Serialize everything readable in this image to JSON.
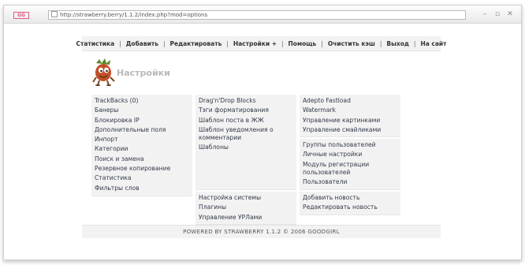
{
  "browser": {
    "app_icon_label": "GG",
    "url": "http://strawberry.berry/1.1.2/index.php?mod=options"
  },
  "menu": [
    {
      "label": "Статистика"
    },
    {
      "label": "Добавить"
    },
    {
      "label": "Редактировать"
    },
    {
      "label": "Настройки +"
    },
    {
      "label": "Помощь"
    },
    {
      "label": "Очистить кэш"
    },
    {
      "label": "Выход"
    },
    {
      "label": "На сайт"
    }
  ],
  "page": {
    "title": "Настройки"
  },
  "columns": {
    "left": [
      {
        "label": "TrackBacks (0)"
      },
      {
        "label": "Банеры"
      },
      {
        "label": "Блокировка IP"
      },
      {
        "label": "Дополнительные поля"
      },
      {
        "label": "Инпорт"
      },
      {
        "label": "Категории"
      },
      {
        "label": "Поиск и замена"
      },
      {
        "label": "Резервное копирование"
      },
      {
        "label": "Статистика"
      },
      {
        "label": "Фильтры слов"
      }
    ],
    "middle_top": [
      {
        "label": "Drag'n'Drop Blocks"
      },
      {
        "label": "Тэги форматирования"
      },
      {
        "label": "Шаблон поста в ЖЖ"
      },
      {
        "label": "Шаблон уведомления о комментарии"
      },
      {
        "label": "Шаблоны"
      }
    ],
    "middle_bottom": [
      {
        "label": "Настройка системы"
      },
      {
        "label": "Плагины"
      },
      {
        "label": "Управление УРЛами"
      }
    ],
    "right_top": [
      {
        "label": "Adepto Fastload"
      },
      {
        "label": "Watermark"
      },
      {
        "label": "Управление картинками"
      },
      {
        "label": "Управление смайликами"
      }
    ],
    "right_middle": [
      {
        "label": "Группы пользователей"
      },
      {
        "label": "Личные настройки"
      },
      {
        "label": "Модуль регистрации пользователей"
      },
      {
        "label": "Пользователи"
      }
    ],
    "right_bottom": [
      {
        "label": "Добавить новость"
      },
      {
        "label": "Редактировать новость"
      }
    ]
  },
  "footer": {
    "text": "POWERED BY STRAWBERRY 1.1.2 © 2006 GOODGIRL"
  }
}
